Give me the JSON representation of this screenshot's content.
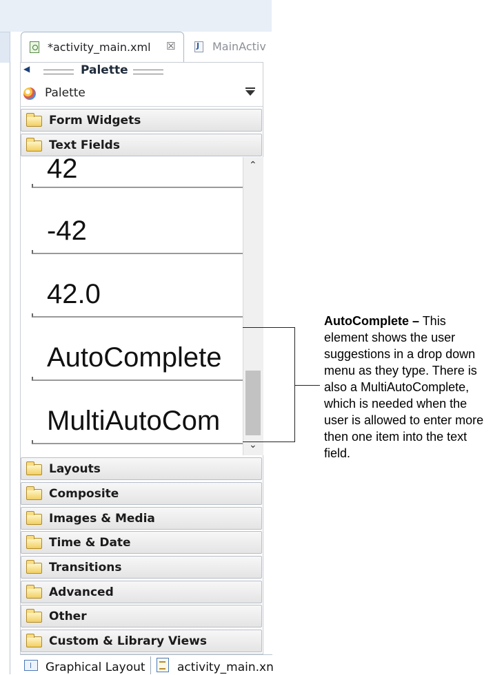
{
  "editor_tabs": {
    "active": "*activity_main.xml",
    "close_glyph": "☒",
    "inactive": "MainActiv"
  },
  "palette": {
    "title": "Palette",
    "dropdown_label": "Palette"
  },
  "categories_top": [
    "Form Widgets",
    "Text Fields"
  ],
  "text_fields": [
    "42",
    "-42",
    "42.0",
    "AutoComplete",
    "MultiAutoCom"
  ],
  "categories_bottom": [
    "Layouts",
    "Composite",
    "Images & Media",
    "Time & Date",
    "Transitions",
    "Advanced",
    "Other",
    "Custom & Library Views"
  ],
  "callout": {
    "heading": "AutoComplete –",
    "body": " This element shows the user suggestions in a drop down menu as they type. There is also a MultiAutoComplete, which is  needed when the user is allowed to enter more then one item into the text field."
  },
  "bottom_tabs": [
    "Graphical Layout",
    "activity_main.xn"
  ],
  "icons": {
    "folder": "folder-icon",
    "palette": "palette-icon",
    "xml_file": "xml-file-icon",
    "java_file": "java-file-icon"
  },
  "colors": {
    "tab_border": "#a9b7c9",
    "folder": "#f2cf63",
    "scroll_thumb": "#c2c2c2"
  }
}
